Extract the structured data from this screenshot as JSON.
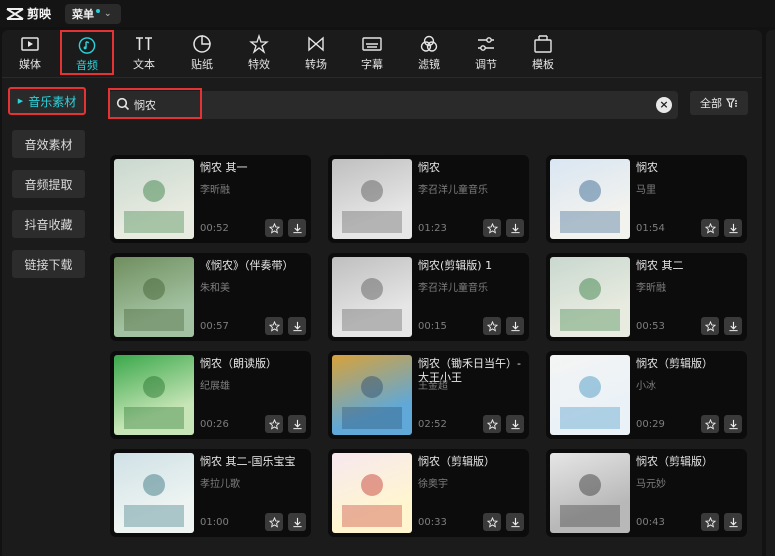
{
  "app": {
    "name": "剪映",
    "menu_label": "菜单"
  },
  "tabs": [
    {
      "label": "媒体",
      "icon": "media-icon"
    },
    {
      "label": "音频",
      "icon": "audio-icon",
      "active": true
    },
    {
      "label": "文本",
      "icon": "text-icon"
    },
    {
      "label": "贴纸",
      "icon": "sticker-icon"
    },
    {
      "label": "特效",
      "icon": "effects-icon"
    },
    {
      "label": "转场",
      "icon": "transition-icon"
    },
    {
      "label": "字幕",
      "icon": "caption-icon"
    },
    {
      "label": "滤镜",
      "icon": "filter-icon"
    },
    {
      "label": "调节",
      "icon": "adjust-icon"
    },
    {
      "label": "模板",
      "icon": "template-icon"
    }
  ],
  "sidebar": {
    "items": [
      {
        "label": "音乐素材",
        "active": true
      },
      {
        "label": "音效素材"
      },
      {
        "label": "音频提取"
      },
      {
        "label": "抖音收藏"
      },
      {
        "label": "链接下载"
      }
    ]
  },
  "search": {
    "value": "悯农",
    "placeholder": ""
  },
  "filter": {
    "label": "全部"
  },
  "colors": {
    "accent": "#2ad3dd",
    "highlight_box": "#e53232"
  },
  "results": [
    {
      "title": "悯农 其一",
      "artist": "李昕融",
      "duration": "00:52"
    },
    {
      "title": "悯农",
      "artist": "李召洋儿童音乐",
      "duration": "01:23"
    },
    {
      "title": "悯农",
      "artist": "马里",
      "duration": "01:54"
    },
    {
      "title": "《悯农》（伴奏带）",
      "artist": "朱和美",
      "duration": "00:57"
    },
    {
      "title": "悯农(剪辑版) 1",
      "artist": "李召洋儿童音乐",
      "duration": "00:15"
    },
    {
      "title": "悯农 其二",
      "artist": "李昕融",
      "duration": "00:53"
    },
    {
      "title": "悯农（朗读版）",
      "artist": "纪展雄",
      "duration": "00:26"
    },
    {
      "title": "悯农（锄禾日当午）-大王小王",
      "artist": "王金超",
      "duration": "02:52"
    },
    {
      "title": "悯农（剪辑版）",
      "artist": "小冰",
      "duration": "00:29"
    },
    {
      "title": "悯农 其二-国乐宝宝",
      "artist": "孝拉儿歌",
      "duration": "01:00"
    },
    {
      "title": "悯农（剪辑版）",
      "artist": "徐奥宇",
      "duration": "00:33"
    },
    {
      "title": "悯农（剪辑版）",
      "artist": "马元妙",
      "duration": "00:43"
    }
  ]
}
